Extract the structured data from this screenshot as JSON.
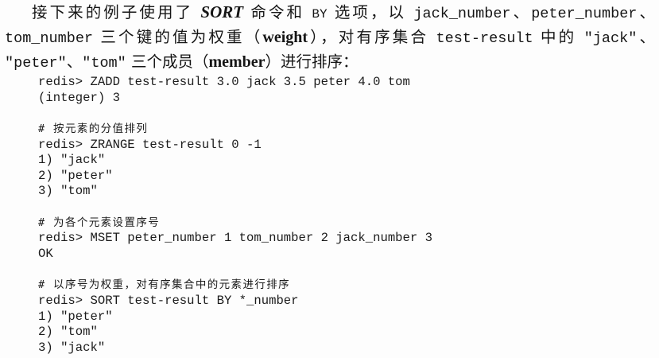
{
  "paragraph": {
    "line1": {
      "s0": "接下来的例子使用了 ",
      "s1": "SORT",
      "s2": " 命令和 ",
      "s3": "BY",
      "s4": " 选项，以 ",
      "s5": "jack_number",
      "s6": "、",
      "s7": "peter_number",
      "s8": "、"
    },
    "line2": {
      "s0": "tom_number",
      "s1": " 三个键的值为权重（",
      "s2": "weight",
      "s3": "），对有序集合 ",
      "s4": "test-result",
      "s5": " 中的 ",
      "s6": "\"jack\"",
      "s7": "、"
    },
    "line3": {
      "s0": "\"peter\"",
      "s1": "、",
      "s2": "\"tom\"",
      "s3": " 三个成员（",
      "s4": "member",
      "s5": "）进行排序："
    }
  },
  "code": {
    "blocks": [
      {
        "lines": [
          "redis> ZADD test-result 3.0 jack 3.5 peter 4.0 tom",
          "(integer) 3"
        ]
      },
      {
        "comment": "# 按元素的分值排列",
        "lines": [
          "redis> ZRANGE test-result 0 -1",
          "1) \"jack\"",
          "2) \"peter\"",
          "3) \"tom\""
        ]
      },
      {
        "comment": "# 为各个元素设置序号",
        "lines": [
          "redis> MSET peter_number 1 tom_number 2 jack_number 3",
          "OK"
        ]
      },
      {
        "comment": "# 以序号为权重，对有序集合中的元素进行排序",
        "lines": [
          "redis> SORT test-result BY *_number",
          "1) \"peter\"",
          "2) \"tom\"",
          "3) \"jack\""
        ]
      }
    ]
  }
}
